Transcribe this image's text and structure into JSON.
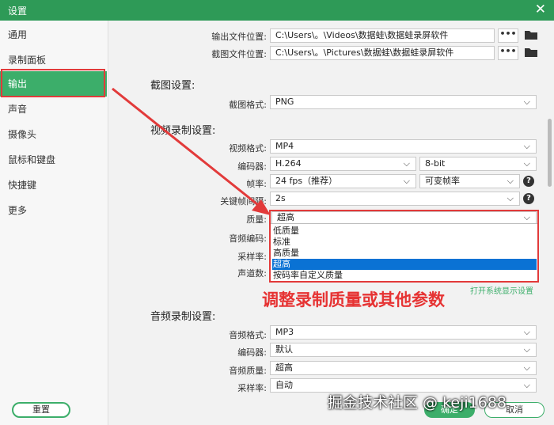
{
  "window": {
    "title": "设置",
    "close_glyph": "✕"
  },
  "sidebar": {
    "items": [
      {
        "label": "通用"
      },
      {
        "label": "录制面板"
      },
      {
        "label": "输出"
      },
      {
        "label": "声音"
      },
      {
        "label": "摄像头"
      },
      {
        "label": "鼠标和键盘"
      },
      {
        "label": "快捷键"
      },
      {
        "label": "更多"
      }
    ],
    "active_index": 2
  },
  "output": {
    "output_folder_label": "输出文件位置:",
    "output_folder_value": "C:\\Users\\。\\Videos\\数据蛙\\数据蛙录屏软件",
    "screenshot_folder_label": "截图文件位置:",
    "screenshot_folder_value": "C:\\Users\\。\\Pictures\\数据蛙\\数据蛙录屏软件",
    "dots": "•••"
  },
  "screenshot_settings": {
    "title": "截图设置:",
    "format_label": "截图格式:",
    "format_value": "PNG"
  },
  "video_settings": {
    "title": "视频录制设置:",
    "format_label": "视频格式:",
    "format_value": "MP4",
    "encoder_label": "编码器:",
    "encoder_value": "H.264",
    "bitdepth_value": "8-bit",
    "framerate_label": "帧率:",
    "framerate_value": "24 fps（推荐）",
    "framerate_mode_value": "可变帧率",
    "keyframe_label": "关键帧间隔:",
    "keyframe_value": "2s",
    "quality_label": "质量:",
    "quality_value": "超高",
    "audio_encoder_label": "音频编码:",
    "sample_rate_label": "采样率:",
    "channels_label": "声道数:",
    "quality_options": [
      "低质量",
      "标准",
      "高质量",
      "超高",
      "按码率自定义质量"
    ],
    "quality_selected_index": 3,
    "open_settings_link": "打开系统显示设置"
  },
  "audio_settings": {
    "title": "音频录制设置:",
    "format_label": "音频格式:",
    "format_value": "MP3",
    "encoder_label": "编码器:",
    "encoder_value": "默认",
    "quality_label": "音频质量:",
    "quality_value": "超高",
    "sample_rate_label": "采样率:",
    "sample_rate_value": "自动"
  },
  "annotation": {
    "text": "调整录制质量或其他参数",
    "color": "#e63333"
  },
  "buttons": {
    "reset": "重置",
    "ok": "确定",
    "cancel": "取消"
  },
  "watermark": "掘金技术社区 @ keji1688",
  "colors": {
    "brand": "#3cae6a",
    "titlebar": "#2e9a57",
    "selection": "#0a72d4",
    "highlight": "#e23a3a"
  },
  "icons": {
    "chevron": "⌵",
    "help": "?"
  }
}
